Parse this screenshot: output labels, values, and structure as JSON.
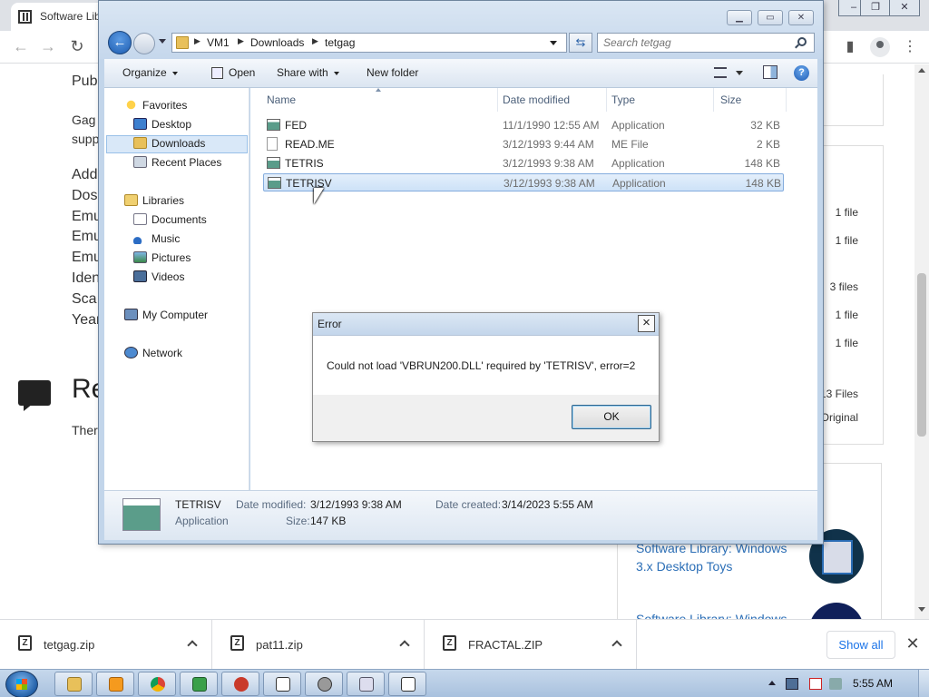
{
  "browser": {
    "tab_title": "Software Lib",
    "page": {
      "lines": [
        "Pub",
        "Gag",
        "supp",
        "Add",
        "Dos",
        "Emu",
        "Emu",
        "Emu",
        "Iden",
        "Sca",
        "Year"
      ],
      "heading": "Re",
      "body_text": "Ther",
      "file_counts": [
        "1 file",
        "1 file",
        "3 files",
        "1 file",
        "1 file",
        "13 Files",
        "Original"
      ],
      "related_link": "Software Library: Windows 3.x Desktop Toys",
      "related_next": "Software Library: Windows"
    }
  },
  "explorer": {
    "breadcrumb": [
      "VM1",
      "Downloads",
      "tetgag"
    ],
    "search_placeholder": "Search tetgag",
    "commands": {
      "organize": "Organize",
      "open": "Open",
      "share_with": "Share with",
      "new_folder": "New folder"
    },
    "nav": {
      "favorites": "Favorites",
      "desktop": "Desktop",
      "downloads": "Downloads",
      "recent_places": "Recent Places",
      "libraries": "Libraries",
      "documents": "Documents",
      "music": "Music",
      "pictures": "Pictures",
      "videos": "Videos",
      "my_computer": "My Computer",
      "network": "Network"
    },
    "columns": {
      "name": "Name",
      "date_modified": "Date modified",
      "type": "Type",
      "size": "Size"
    },
    "files": [
      {
        "name": "FED",
        "date": "11/1/1990 12:55 AM",
        "type": "Application",
        "size": "32 KB",
        "icon": "application-icon"
      },
      {
        "name": "READ.ME",
        "date": "3/12/1993 9:44 AM",
        "type": "ME File",
        "size": "2 KB",
        "icon": "document-icon"
      },
      {
        "name": "TETRIS",
        "date": "3/12/1993 9:38 AM",
        "type": "Application",
        "size": "148 KB",
        "icon": "application-icon"
      },
      {
        "name": "TETRISV",
        "date": "3/12/1993 9:38 AM",
        "type": "Application",
        "size": "148 KB",
        "icon": "application-icon",
        "selected": true
      }
    ],
    "details": {
      "name": "TETRISV",
      "kind": "Application",
      "date_modified_label": "Date modified:",
      "date_modified": "3/12/1993 9:38 AM",
      "size_label": "Size:",
      "size": "147 KB",
      "date_created_label": "Date created:",
      "date_created": "3/14/2023 5:55 AM"
    }
  },
  "error_dialog": {
    "title": "Error",
    "message": "Could not load 'VBRUN200.DLL' required by 'TETRISV', error=2",
    "ok_label": "OK"
  },
  "downloads": {
    "items": [
      "tetgag.zip",
      "pat11.zip",
      "FRACTAL.ZIP"
    ],
    "show_all": "Show all"
  },
  "taskbar": {
    "clock": "5:55 AM",
    "pinned": [
      "explorer-icon",
      "media-player-icon",
      "chrome-icon",
      "app-icon",
      "app-icon",
      "app-icon",
      "app-icon",
      "app-icon",
      "app-icon"
    ]
  },
  "colors": {
    "link": "#2c6fb7",
    "selection": "#cde2f8",
    "taskbar": "#b7cce5"
  }
}
